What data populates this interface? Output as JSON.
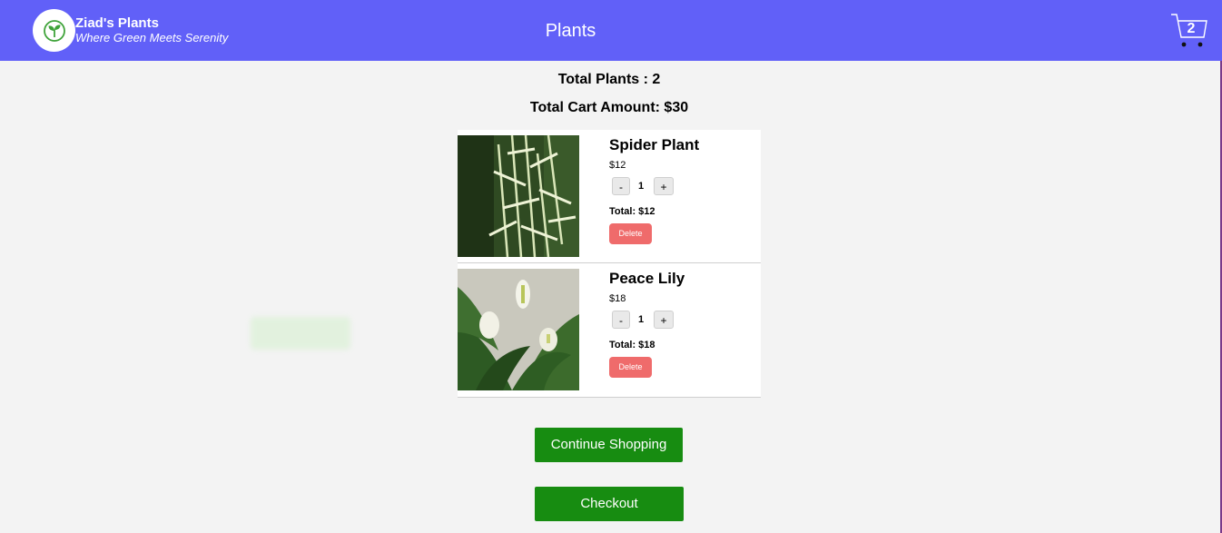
{
  "brand": {
    "name": "Ziad's Plants",
    "tagline": "Where Green Meets Serenity"
  },
  "nav": {
    "title": "Plants",
    "cart_count": "2"
  },
  "cart": {
    "total_plants": "Total Plants : 2",
    "total_amount": "Total Cart Amount: $30",
    "items": [
      {
        "name": "Spider Plant",
        "price": "$12",
        "minus": "-",
        "qty": "1",
        "plus": "+",
        "total": "Total: $12",
        "delete": "Delete"
      },
      {
        "name": "Peace Lily",
        "price": "$18",
        "minus": "-",
        "qty": "1",
        "plus": "+",
        "total": "Total: $18",
        "delete": "Delete"
      }
    ],
    "continue_label": "Continue Shopping",
    "checkout_label": "Checkout"
  },
  "colors": {
    "navbar": "#6160f8",
    "primary_button": "#178c11",
    "delete_button": "#ef6b6b"
  },
  "icons": {
    "logo": "leaf-icon",
    "cart": "cart-icon"
  }
}
